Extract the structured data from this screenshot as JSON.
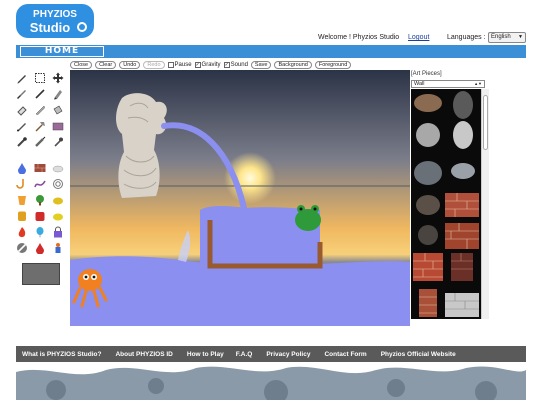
{
  "header": {
    "logo_line1": "PHYZIOS",
    "logo_line2": "Studio",
    "welcome": "Welcome ! Phyzios Studio",
    "logout": "Logout",
    "languages_label": "Languages :",
    "language_selected": "English"
  },
  "nav": {
    "home": "HOME"
  },
  "toolbar": {
    "close": "Close",
    "clear": "Clear",
    "undo": "Undo",
    "redo": "Redo",
    "pause": "Pause",
    "gravity": "Gravity",
    "sound": "Sound",
    "save": "Save",
    "background": "Background",
    "foreground": "Foreground",
    "pause_checked": false,
    "gravity_checked": true,
    "sound_checked": true
  },
  "art_panel": {
    "title": "[Art Pieces]",
    "category": "Wall"
  },
  "footer": {
    "links": [
      "What is PHYZIOS Studio?",
      "About PHYZIOS ID",
      "How to Play",
      "F.A.Q",
      "Privacy Policy",
      "Contact Form",
      "Phyzios Official Website"
    ]
  },
  "colors": {
    "nav_blue": "#3a8fd6",
    "water": "#8a8ff0",
    "footer_gray": "#5a5a5a",
    "logo_blue": "#2f8fe0"
  },
  "icons": [
    "pencil-icon",
    "select-rect-icon",
    "move-icon",
    "brush-icon",
    "line-icon",
    "marker-icon",
    "eraser-icon",
    "knife-icon",
    "bucket-icon",
    "pen-icon",
    "axe-icon",
    "rectangle-icon",
    "dropper-icon",
    "syringe-icon",
    "pipette-icon",
    "water-drop-icon",
    "brick-icon",
    "cloud-icon",
    "hook-icon",
    "rope-icon",
    "spiral-icon",
    "cup-icon",
    "tree-icon",
    "foliage-icon",
    "barrel-icon",
    "apple-icon",
    "sponge-icon",
    "fire-icon",
    "balloon-icon",
    "lock-icon",
    "no-entry-icon",
    "drop-icon",
    "figure-icon"
  ]
}
